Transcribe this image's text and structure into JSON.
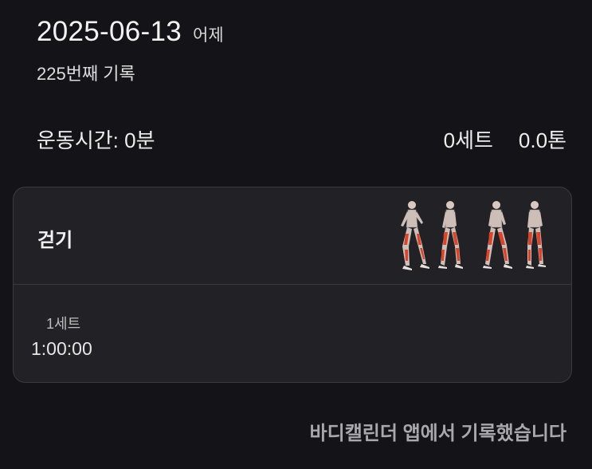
{
  "header": {
    "date": "2025-06-13",
    "relative_day": "어제",
    "record_count": "225번째 기록"
  },
  "stats": {
    "workout_time": "운동시간: 0분",
    "sets": "0세트",
    "volume": "0.0톤"
  },
  "exercise": {
    "name": "걷기",
    "illustration": "walking-muscle-figures-icon",
    "sets": [
      {
        "label": "1세트",
        "value": "1:00:00"
      }
    ]
  },
  "footer": {
    "note": "바디캘린더 앱에서 기록했습니다"
  },
  "colors": {
    "background": "#141418",
    "card": "#222226",
    "muscle_highlight": "#d9442c"
  }
}
